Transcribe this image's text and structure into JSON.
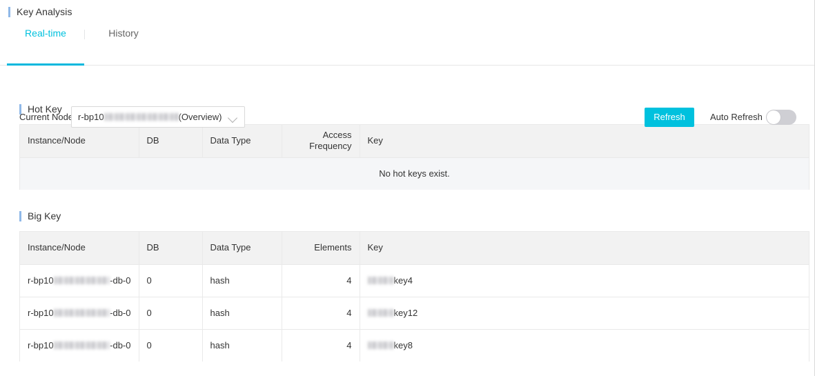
{
  "page": {
    "title": "Key Analysis"
  },
  "tabs": [
    {
      "label": "Real-time",
      "active": true
    },
    {
      "label": "History",
      "active": false
    }
  ],
  "toolbar": {
    "node_label": "Current Node",
    "node_value_prefix": "r-bp10",
    "node_value_suffix": "(Overview)",
    "node_redacted_width": 108,
    "refresh_label": "Refresh",
    "auto_refresh_label": "Auto Refresh",
    "auto_refresh_on": false
  },
  "hot_key": {
    "section_title": "Hot Key",
    "columns": [
      "Instance/Node",
      "DB",
      "Data Type",
      "Access Frequency",
      "Key"
    ],
    "rows": [],
    "empty_text": "No hot keys exist."
  },
  "big_key": {
    "section_title": "Big Key",
    "columns": [
      "Instance/Node",
      "DB",
      "Data Type",
      "Elements",
      "Key"
    ],
    "rows": [
      {
        "instance_prefix": "r-bp10",
        "instance_redacted_width": 112,
        "instance_suffix": "-db-0",
        "db": "0",
        "data_type": "hash",
        "elements": "4",
        "key_redacted_width": 38,
        "key_suffix": "key4"
      },
      {
        "instance_prefix": "r-bp10",
        "instance_redacted_width": 112,
        "instance_suffix": "-db-0",
        "db": "0",
        "data_type": "hash",
        "elements": "4",
        "key_redacted_width": 38,
        "key_suffix": "key12"
      },
      {
        "instance_prefix": "r-bp10",
        "instance_redacted_width": 112,
        "instance_suffix": "-db-0",
        "db": "0",
        "data_type": "hash",
        "elements": "4",
        "key_redacted_width": 38,
        "key_suffix": "key8"
      }
    ]
  },
  "colors": {
    "accent_bar": "#8fb8e8",
    "tab_active": "#00c1de",
    "tab_underline": "#00b7dd",
    "refresh_button": "#00c1de",
    "table_header_bg": "#f2f2f2",
    "empty_state_bg": "#f5f6f8",
    "border": "#e9e9e9"
  },
  "icons": {
    "chevron_down": "chevron-down-icon"
  }
}
